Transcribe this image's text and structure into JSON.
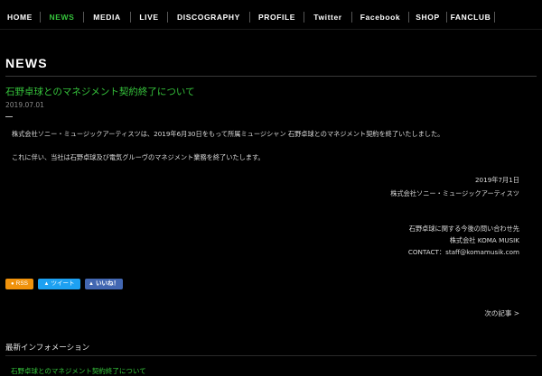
{
  "nav": {
    "items": [
      {
        "label": "HOME",
        "active": false
      },
      {
        "label": "NEWS",
        "active": true
      },
      {
        "label": "MEDIA",
        "active": false
      },
      {
        "label": "LIVE",
        "active": false
      },
      {
        "label": "DISCOGRAPHY",
        "active": false
      },
      {
        "label": "PROFILE",
        "active": false
      },
      {
        "label": "Twitter",
        "active": false
      },
      {
        "label": "Facebook",
        "active": false
      },
      {
        "label": "SHOP",
        "active": false
      },
      {
        "label": "FANCLUB",
        "active": false
      }
    ]
  },
  "section_title": "NEWS",
  "article": {
    "title": "石野卓球とのマネジメント契約終了について",
    "date": "2019.07.01",
    "paragraphs": [
      "株式会社ソニー・ミュージックアーティスツは、2019年6月30日をもって所属ミュージシャン 石野卓球とのマネジメント契約を終了いたしました。",
      "これに伴い、当社は石野卓球及び電気グルーヴのマネジメント業務を終了いたします。"
    ],
    "signature": {
      "date": "2019年7月1日",
      "company": "株式会社ソニー・ミュージックアーティスツ"
    },
    "contact": {
      "heading": "石野卓球に関する今後の問い合わせ先",
      "company": "株式会社 KOMA MUSIK",
      "line": "CONTACT：staff@komamusik.com"
    }
  },
  "share": {
    "rss_label": "RSS",
    "tweet_label": "ツイート",
    "like_label": "いいね！"
  },
  "next_link": "次の記事 >",
  "latest": {
    "heading": "最新インフォメーション",
    "items": [
      "石野卓球とのマネジメント契約終了について"
    ]
  },
  "colors": {
    "accent": "#35c23b",
    "background": "#000000",
    "rss": "#f0920c",
    "twitter": "#1da1f2",
    "facebook": "#4267b2"
  }
}
